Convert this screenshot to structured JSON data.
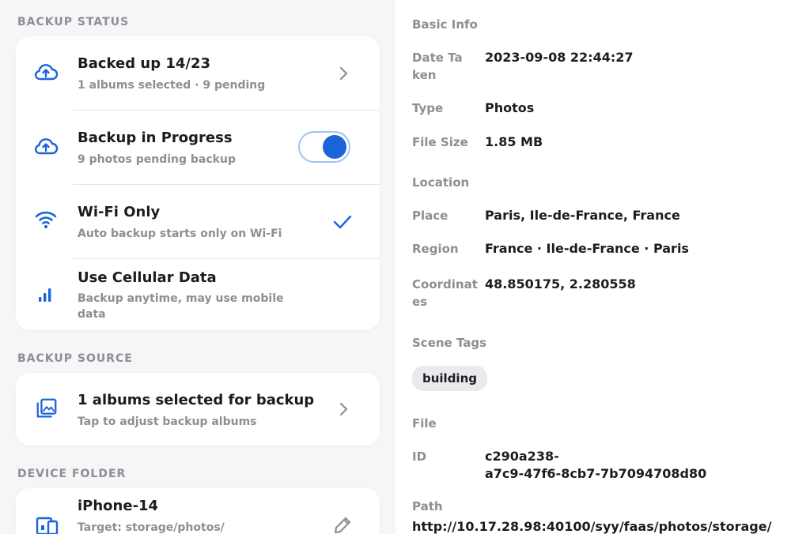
{
  "backup_status": {
    "section_title": "BACKUP STATUS",
    "rows": [
      {
        "title": "Backed up 14/23",
        "subtitle": "1 albums selected · 9 pending",
        "icon": "cloud-upload-icon",
        "trailing": "chevron"
      },
      {
        "title": "Backup in Progress",
        "subtitle": "9 photos pending backup",
        "icon": "cloud-upload-icon",
        "trailing": "toggle",
        "toggle_on": true
      },
      {
        "title": "Wi-Fi Only",
        "subtitle": "Auto backup starts only on Wi-Fi",
        "icon": "wifi-icon",
        "trailing": "checkmark",
        "checked": true
      },
      {
        "title": "Use Cellular Data",
        "subtitle": "Backup anytime, may use mobile data",
        "icon": "cellular-signal-icon",
        "trailing": "none"
      }
    ]
  },
  "backup_source": {
    "section_title": "BACKUP SOURCE",
    "title": "1 albums selected for backup",
    "subtitle": "Tap to adjust backup albums",
    "icon": "photo-album-icon"
  },
  "device_folder": {
    "section_title": "DEVICE FOLDER",
    "title": "iPhone-14",
    "subtitle": "Target: storage/photos/",
    "icon": "devices-icon",
    "action_icon": "edit-pencil-icon"
  },
  "details": {
    "basic_info_header": "Basic Info",
    "date_label": "Date Taken",
    "date_value": "2023-09-08 22:44:27",
    "type_label": "Type",
    "type_value": "Photos",
    "size_label": "File Size",
    "size_value": "1.85 MB",
    "location_header": "Location",
    "place_label": "Place",
    "place_value": "Paris, Ile-de-France, France",
    "region_label": "Region",
    "region_value": "France · Ile-de-France · Paris",
    "coord_label": "Coordinates",
    "coord_value": "48.850175, 2.280558",
    "scene_header": "Scene Tags",
    "scene_tags": [
      "building"
    ],
    "file_header": "File",
    "id_label": "ID",
    "id_value_line1": "c290a238-",
    "id_value_line2": "a7c9-47f6-8cb7-7b7094708d80",
    "path_label": "Path",
    "path_value": "http://10.17.28.98:40100/syy/faas/photos/storage/"
  },
  "colors": {
    "accent": "#1a64d9",
    "secondary_text": "#8e8e93",
    "background": "#f6f6f8"
  }
}
